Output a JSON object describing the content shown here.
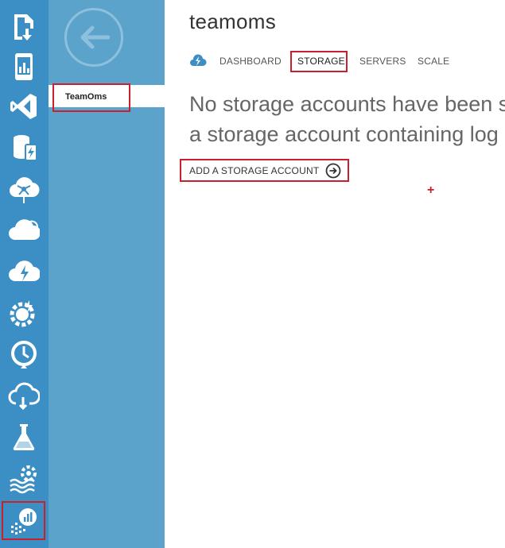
{
  "colors": {
    "rail": "#3b8fc4",
    "nav_panel": "#5ba3cb",
    "highlight": "#c8202c",
    "title_text": "#333333",
    "message_text": "#666666"
  },
  "rail": {
    "icons": [
      "document-deploy-icon",
      "mobile-chart-icon",
      "visual-studio-icon",
      "database-bolt-icon",
      "hdinsight-hub-icon",
      "cloud-services-icon",
      "cloud-bolt-icon",
      "gear-bolt-icon",
      "clock-refresh-icon",
      "cloud-sync-icon",
      "flask-icon",
      "wave-gear-icon",
      "operational-insights-icon"
    ]
  },
  "nav": {
    "back_icon": "arrow-left-icon",
    "items": [
      {
        "label": "TeamOms"
      }
    ]
  },
  "main": {
    "title": "teamoms",
    "tabs_icon": "cloud-bolt-small-icon",
    "tabs": [
      {
        "label": "DASHBOARD"
      },
      {
        "label": "STORAGE"
      },
      {
        "label": "SERVERS"
      },
      {
        "label": "SCALE"
      }
    ],
    "message_line1": "No storage accounts have been s",
    "message_line2": "a storage account containing log",
    "add_button_label": "ADD A STORAGE ACCOUNT",
    "add_button_icon": "arrow-right-circle-icon",
    "plus_mark": "+"
  }
}
